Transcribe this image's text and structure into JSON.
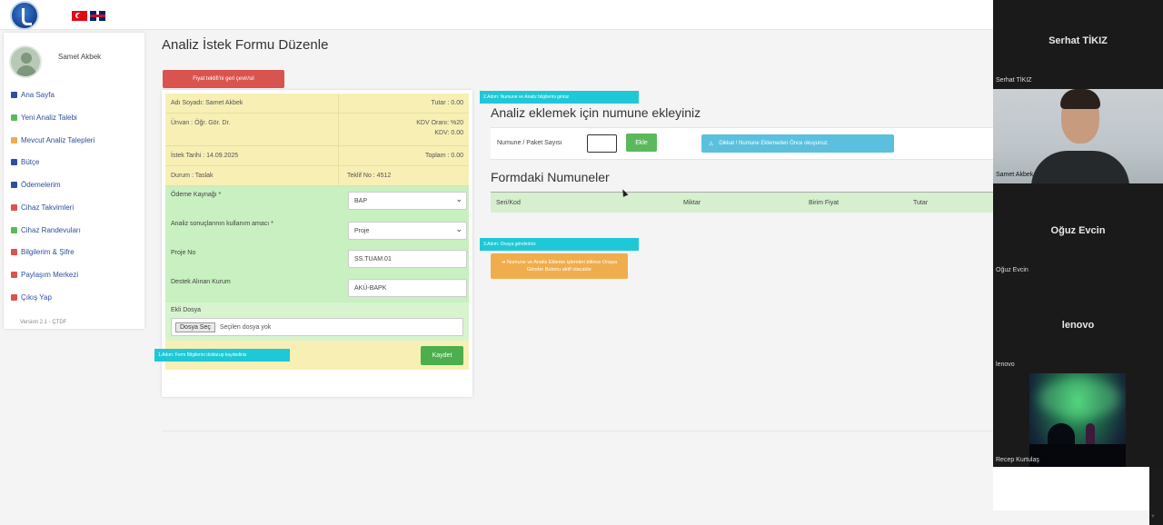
{
  "topbar": {
    "logo": "logo-icon",
    "flags": [
      "turkey-flag-icon",
      "uk-flag-icon"
    ]
  },
  "sidebar": {
    "user_name": "Samet Akbek",
    "items": [
      {
        "label": "Ana Sayfa",
        "icon": "home-icon",
        "color": "#2d4f9c"
      },
      {
        "label": "Yeni Analiz Talebi",
        "icon": "add-icon",
        "color": "#5cb85c"
      },
      {
        "label": "Mevcut Analiz Talepleri",
        "icon": "list-icon",
        "color": "#f0ad4e"
      },
      {
        "label": "Bütçe",
        "icon": "budget-icon",
        "color": "#2d4f9c"
      },
      {
        "label": "Ödemelerim",
        "icon": "payment-icon",
        "color": "#2d4f9c"
      },
      {
        "label": "Cihaz Takvimleri",
        "icon": "calendar-icon",
        "color": "#d9534f"
      },
      {
        "label": "Cihaz Randevuları",
        "icon": "appointment-icon",
        "color": "#5cb85c"
      },
      {
        "label": "Bilgilerim & Şifre",
        "icon": "key-icon",
        "color": "#d9534f"
      },
      {
        "label": "Paylaşım Merkezi",
        "icon": "share-icon",
        "color": "#d9534f"
      },
      {
        "label": "Çıkış Yap",
        "icon": "logout-icon",
        "color": "#d9534f"
      }
    ],
    "version": "Version 2.1 - ÇTDF"
  },
  "main": {
    "title": "Analiz İstek Formu Düzenle",
    "reject_button": "Fiyat teklifi'ni geri çevir/sil",
    "info": {
      "requester": "Adı Soyadı: Samet Akbek",
      "total": "Tutar : 0.00",
      "title": "Ünvan : Öğr. Gör. Dr.",
      "kdv_rate": "KDV Oranı: %20",
      "kdv": "KDV: 0.00",
      "request_date": "İstek Tarihi : 14.09.2025",
      "grand_total": "Toplam : 0.00",
      "status": "Durum : Taslak",
      "offer_no": "Teklif No : 4512"
    },
    "fields": {
      "payment_source_label": "Ödeme Kaynağı *",
      "payment_source_value": "BAP",
      "purpose_label": "Analiz sonuçlarının kullanım amacı *",
      "purpose_value": "Proje",
      "project_no_label": "Proje No",
      "project_no_value": "SS.TUAM.01",
      "support_label": "Destek Alınan Kurum",
      "support_value": "AKÜ-BAPK",
      "file_label": "Ekli Dosya",
      "file_button": "Dosya Seç",
      "file_status": "Seçilen dosya yok"
    },
    "save_button": "Kaydet",
    "step_tags": {
      "step1": "1.Adım: Form Bilgilerini doldurup kaydediniz",
      "step2": "2.Adım: Numune ve Analiz bilgilerini giriniz",
      "step3": "3.Adım: Onaya gönderiniz"
    },
    "add_sample": {
      "title": "Analiz eklemek için numune ekleyiniz",
      "label": "Numune / Paket Sayısı",
      "input_value": "",
      "add_button": "Ekle",
      "warning": "Dikkat ! Numune Eklemeden Önce okuyunuz"
    },
    "samples": {
      "title": "Formdaki Numuneler",
      "columns": [
        "Seri/Kod",
        "Miktar",
        "Birim Fiyat",
        "Tutar"
      ]
    },
    "summary_button": "➜ Numune ve Analiz Ekleme işlemleri bitince Onaya Gönder Butonu aktif olacaktır"
  },
  "call": {
    "participants": [
      {
        "name": "Serhat TİKIZ",
        "label": "Serhat TİKIZ"
      },
      {
        "name": "",
        "label": "Samet Akbek"
      },
      {
        "name": "Oğuz Evcin",
        "label": "Oğuz Evcin"
      },
      {
        "name": "lenovo",
        "label": "lenovo"
      },
      {
        "name": "",
        "label": "Recep Kurtulaş"
      }
    ]
  }
}
